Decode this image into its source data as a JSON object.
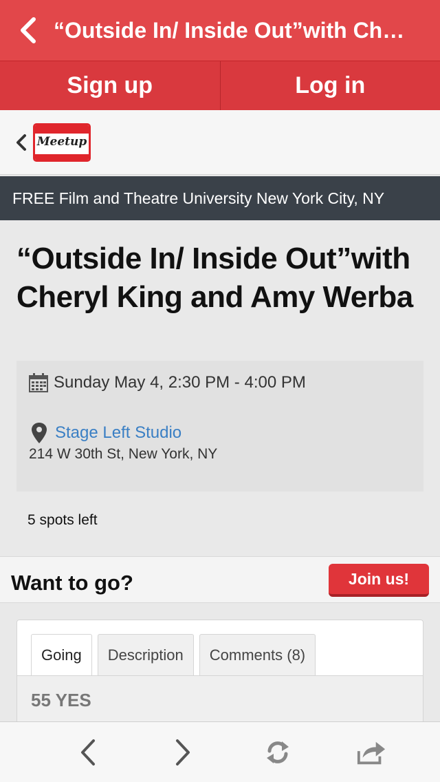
{
  "topbar": {
    "back_icon": "chevron-left-icon",
    "title": "“Outside In/ Inside Out”with Ch…"
  },
  "auth": {
    "signup_label": "Sign up",
    "login_label": "Log in"
  },
  "brand": {
    "back_icon": "chevron-left-icon",
    "logo_text": "Meetup",
    "colors": {
      "red": "#e0262c"
    }
  },
  "group": {
    "name": "FREE Film and Theatre University New York City, NY"
  },
  "event": {
    "title": "“Outside In/ Inside Out”with Cheryl King and Amy Werba",
    "date_icon": "calendar-icon",
    "datetime": "Sunday May 4, 2:30 PM - 4:00 PM",
    "location_icon": "map-pin-icon",
    "venue": "Stage Left Studio",
    "address": "214 W 30th St, New York, NY",
    "spots": "5 spots left"
  },
  "rsvp": {
    "question": "Want to go?",
    "join_label": "Join us!"
  },
  "tabs": {
    "items": [
      {
        "label": "Going",
        "active": true
      },
      {
        "label": "Description",
        "active": false
      },
      {
        "label": "Comments (8)",
        "active": false
      }
    ],
    "yes_count": "55 YES"
  },
  "toolbar": {
    "icons": [
      "back-icon",
      "forward-icon",
      "refresh-icon",
      "share-icon"
    ]
  },
  "colors": {
    "accent": "#e2474a",
    "link": "#3a7fc4",
    "group_bar": "#3a4149"
  }
}
